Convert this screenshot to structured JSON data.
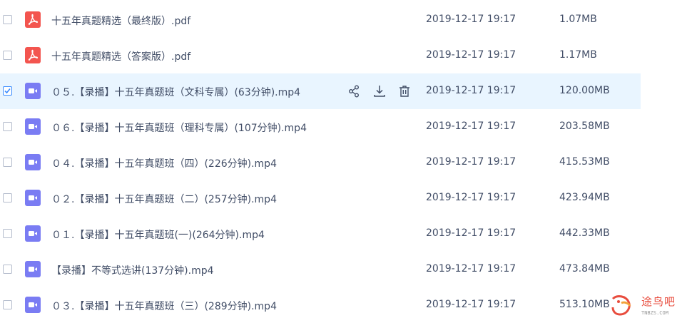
{
  "files": [
    {
      "name": "十五年真题精选（最终版）.pdf",
      "type": "pdf",
      "date": "2019-12-17 19:17",
      "size": "1.07MB",
      "selected": false
    },
    {
      "name": "十五年真题精选（答案版）.pdf",
      "type": "pdf",
      "date": "2019-12-17 19:17",
      "size": "1.17MB",
      "selected": false
    },
    {
      "name": "０５.【录播】十五年真题班（文科专属）(63分钟).mp4",
      "type": "video",
      "date": "2019-12-17 19:17",
      "size": "120.00MB",
      "selected": true
    },
    {
      "name": "０６.【录播】十五年真题班（理科专属）(107分钟).mp4",
      "type": "video",
      "date": "2019-12-17 19:17",
      "size": "203.58MB",
      "selected": false
    },
    {
      "name": "０４.【录播】十五年真题班（四）(226分钟).mp4",
      "type": "video",
      "date": "2019-12-17 19:17",
      "size": "415.53MB",
      "selected": false
    },
    {
      "name": "０２.【录播】十五年真题班（二）(257分钟).mp4",
      "type": "video",
      "date": "2019-12-17 19:17",
      "size": "423.94MB",
      "selected": false
    },
    {
      "name": "０１.【录播】十五年真题班(一)(264分钟).mp4",
      "type": "video",
      "date": "2019-12-17 19:17",
      "size": "442.33MB",
      "selected": false
    },
    {
      "name": "【录播】不等式选讲(137分钟).mp4",
      "type": "video",
      "date": "2019-12-17 19:17",
      "size": "473.84MB",
      "selected": false
    },
    {
      "name": "０３.【录播】十五年真题班（三）(289分钟).mp4",
      "type": "video",
      "date": "2019-12-17 19:17",
      "size": "513.10MB",
      "selected": false
    }
  ],
  "row_actions": [
    "share-icon",
    "download-icon",
    "delete-icon"
  ],
  "watermark": {
    "text": "途鸟吧",
    "sub": "TNBZS.COM"
  },
  "colors": {
    "selected_row": "#e9f5ff",
    "pdf_icon": "#f3554f",
    "video_icon": "#7a7cf3",
    "checkbox_checked": "#3b8cff",
    "watermark": "#e84c3d"
  }
}
